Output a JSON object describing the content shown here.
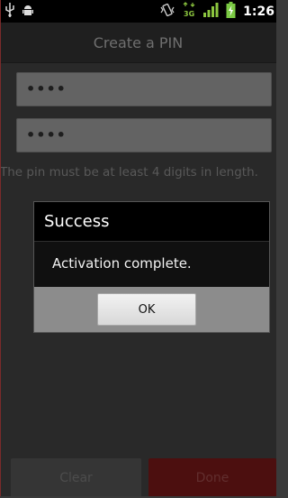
{
  "statusbar": {
    "time": "1:26",
    "icons": [
      "usb-icon",
      "android-icon",
      "vibrate-icon",
      "3g-icon",
      "signal-icon",
      "battery-charging-icon"
    ]
  },
  "titlebar": {
    "title": "Create a PIN"
  },
  "form": {
    "pin_value": "••••",
    "confirm_value": "••••",
    "hint": "The pin must be at least 4 digits in length."
  },
  "dialog": {
    "title": "Success",
    "message": "Activation complete.",
    "ok_label": "OK"
  },
  "actions": {
    "clear_label": "Clear",
    "done_label": "Done"
  },
  "colors": {
    "done_button": "#6a1515",
    "clear_button": "#4a4a4a",
    "dialog_title_bg": "#000000",
    "battery_green": "#7ac943"
  }
}
